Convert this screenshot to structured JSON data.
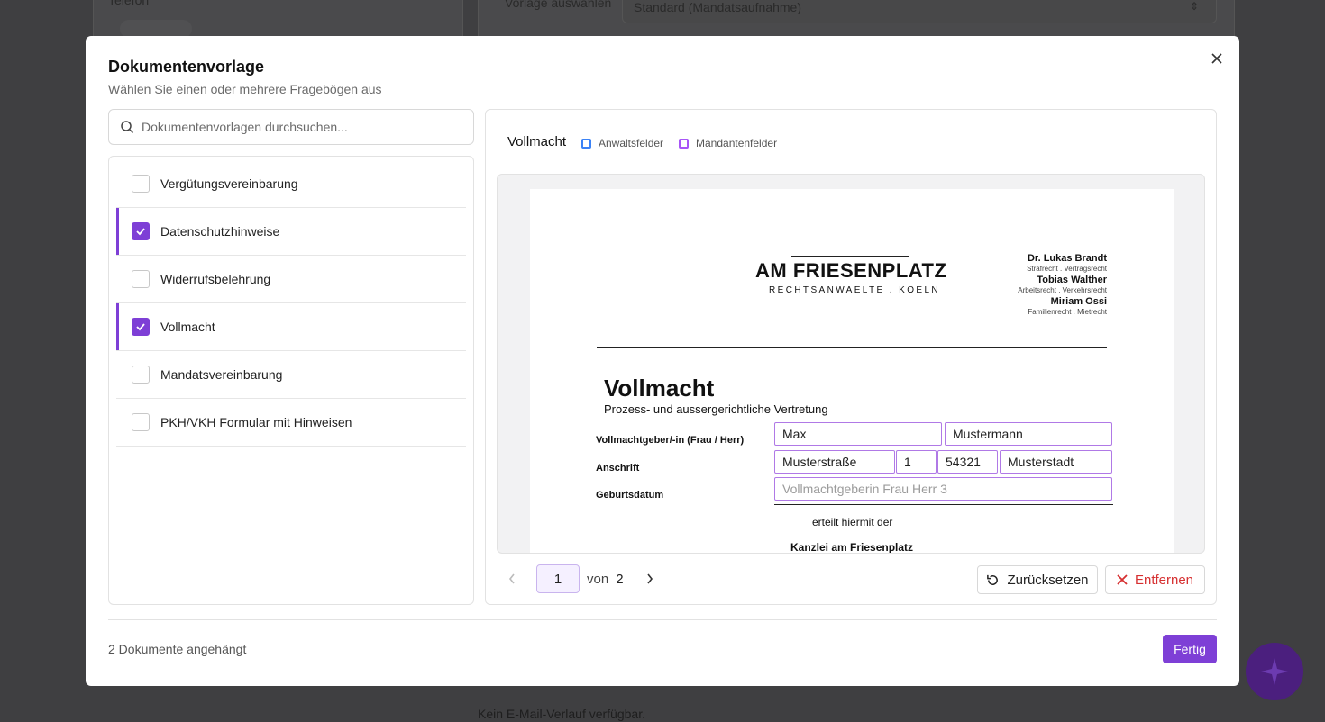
{
  "background": {
    "left_label": "Telefon",
    "select_label": "Vorlage auswählen",
    "select_value": "Standard (Mandatsaufnahme)",
    "footer_text": "Kein E-Mail-Verlauf verfügbar."
  },
  "modal": {
    "title": "Dokumentenvorlage",
    "subtitle": "Wählen Sie einen oder mehrere Fragebögen aus",
    "search_placeholder": "Dokumentenvorlagen durchsuchen...",
    "templates": [
      {
        "label": "Vergütungsvereinbarung",
        "checked": false
      },
      {
        "label": "Datenschutzhinweise",
        "checked": true
      },
      {
        "label": "Widerrufsbelehrung",
        "checked": false
      },
      {
        "label": "Vollmacht",
        "checked": true
      },
      {
        "label": "Mandatsvereinbarung",
        "checked": false
      },
      {
        "label": "PKH/VKH Formular mit Hinweisen",
        "checked": false
      }
    ],
    "preview": {
      "title": "Vollmacht",
      "legend": {
        "lawyer": "Anwaltsfelder",
        "client": "Mandantenfelder"
      },
      "lawyer_color": "#3b82f6",
      "client_color": "#a855f7"
    },
    "document": {
      "logo_title": "AM FRIESENPLATZ",
      "logo_subtitle": "RECHTSANWAELTE . KOELN",
      "lawyers": [
        {
          "name": "Dr. Lukas Brandt",
          "areas": "Strafrecht  .  Vertragsrecht"
        },
        {
          "name": "Tobias Walther",
          "areas": "Arbeitsrecht  .  Verkehrsrecht"
        },
        {
          "name": "Miriam Ossi",
          "areas": "Familienrecht  .  Mietrecht"
        }
      ],
      "heading": "Vollmacht",
      "subheading": "Prozess- und aussergerichtliche Vertretung",
      "label_principal": "Vollmachtgeber/-in (Frau / Herr)",
      "label_address": "Anschrift",
      "label_birthdate": "Geburtsdatum",
      "first_name": "Max",
      "last_name": "Mustermann",
      "street": "Musterstraße",
      "house_no": "1",
      "zip": "54321",
      "city": "Musterstadt",
      "birthdate_placeholder": "Vollmachtgeberin Frau Herr 3",
      "grants_text": "erteilt hiermit der",
      "firm_name": "Kanzlei am Friesenplatz"
    },
    "pager": {
      "current": "1",
      "of_label": "von",
      "total": "2"
    },
    "reset_label": "Zurücksetzen",
    "remove_label": "Entfernen",
    "footer_status": "2 Dokumente angehängt",
    "done_label": "Fertig"
  },
  "colors": {
    "accent": "#7e3fd6",
    "danger": "#d63031"
  }
}
